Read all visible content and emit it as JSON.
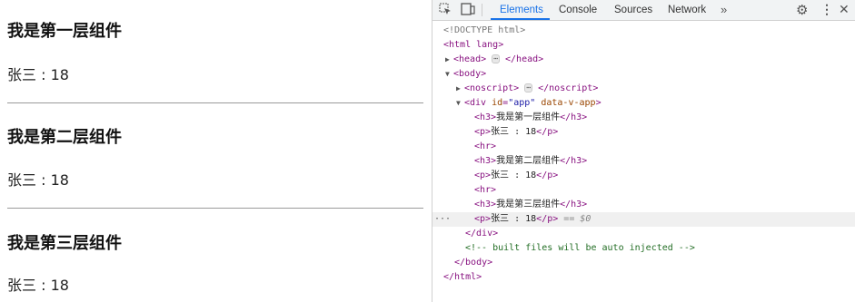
{
  "page": {
    "heading_1": "我是第一层组件",
    "text_1": "张三 : 18",
    "heading_2": "我是第二层组件",
    "text_2": "张三 : 18",
    "heading_3": "我是第三层组件",
    "text_3": "张三 : 18"
  },
  "devtools": {
    "tabs": [
      "Elements",
      "Console",
      "Sources",
      "Network"
    ],
    "more_tabs": "»",
    "active_tab": "Elements",
    "dom": {
      "doctype": "<!DOCTYPE html>",
      "html_open": "<html lang>",
      "head_open": "<head>",
      "head_close": "</head>",
      "body_open": "<body>",
      "noscript_open": "<noscript>",
      "noscript_close": "</noscript>",
      "div_open_tag": "<div",
      "div_id_attr": "id",
      "div_id_val": "\"app\"",
      "div_data_attr": "data-v-app",
      "div_open_end": ">",
      "h3_1": "我是第一层组件",
      "p_1": "张三 : 18",
      "h3_2": "我是第二层组件",
      "p_2": "张三 : 18",
      "h3_3": "我是第三层组件",
      "p_3": "张三 : 18",
      "selected_marker": "== $0",
      "div_close": "</div>",
      "comment": "<!-- built files will be auto injected -->",
      "body_close": "</body>",
      "html_close": "</html>",
      "h3_open": "<h3>",
      "h3_close": "</h3>",
      "p_open": "<p>",
      "p_close": "</p>",
      "hr": "<hr>",
      "ellipsis": "⋯",
      "gutter_dots": "···"
    }
  },
  "icons": {
    "inspect": "inspect-element-icon",
    "device": "device-toolbar-icon",
    "settings": "gear-icon",
    "menu": "kebab-menu-icon",
    "close": "close-icon"
  },
  "colors": {
    "active_tab": "#1a73e8",
    "tag": "#881280",
    "attribute": "#994500",
    "attribute_value": "#1a1aa6",
    "comment": "#236e25"
  }
}
